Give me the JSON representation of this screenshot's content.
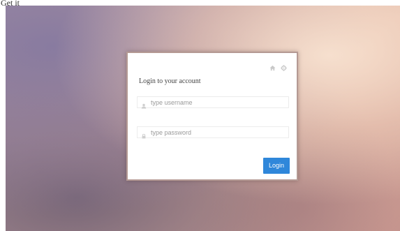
{
  "page": {
    "top_label": "Get it"
  },
  "icons": {
    "home": "home-icon",
    "settings": "gear-icon",
    "user": "user-icon",
    "lock": "lock-icon"
  },
  "login_card": {
    "title": "Login to your account",
    "username": {
      "value": "",
      "placeholder": "type username"
    },
    "password": {
      "value": "",
      "placeholder": "type password"
    },
    "login_label": "Login"
  },
  "colors": {
    "button": "#2f87da",
    "card_border": "#b59a94"
  }
}
